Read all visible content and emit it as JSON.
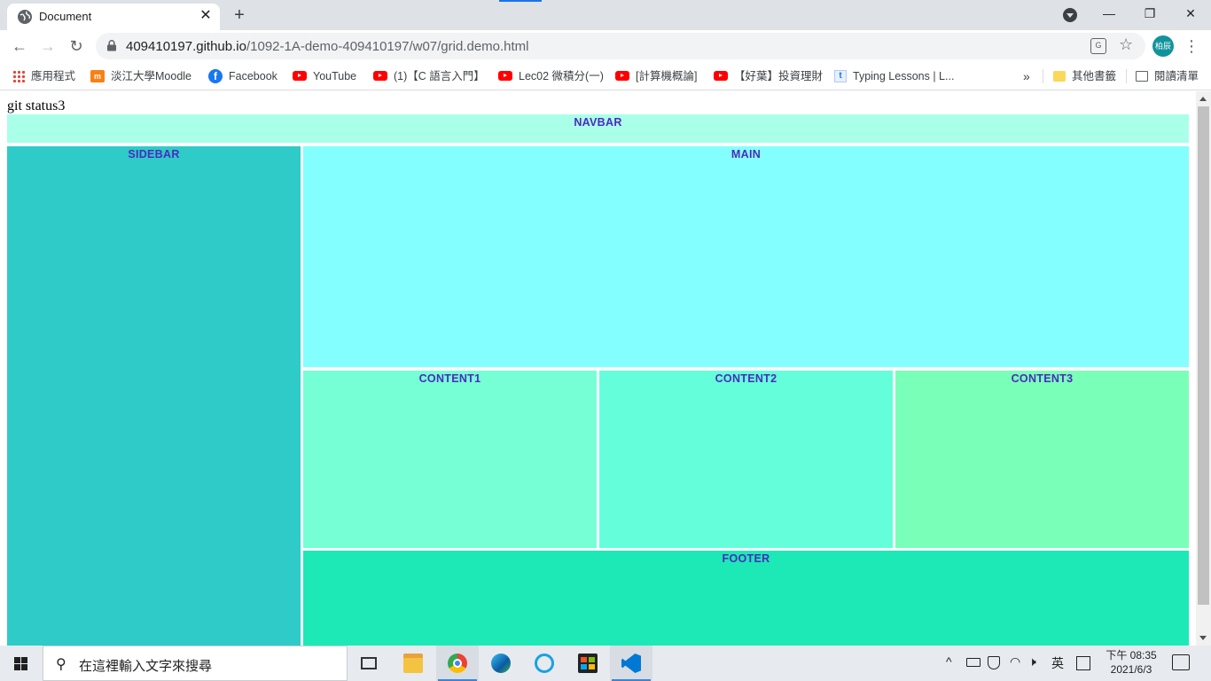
{
  "browser": {
    "tab_title": "Document",
    "tab_close": "✕",
    "new_tab": "+",
    "window": {
      "minimize": "—",
      "restore": "❐",
      "close": "✕"
    },
    "nav": {
      "back": "←",
      "forward": "→",
      "reload": "↻"
    },
    "url_host": "409410197.github.io",
    "url_path": "/1092-1A-demo-409410197/w07/grid.demo.html",
    "translate_icon_text": "G",
    "star": "☆",
    "profile_initials": "柏辰",
    "menu": "⋮"
  },
  "bookmarks": {
    "items": [
      {
        "label": "應用程式",
        "icon": "apps-icon"
      },
      {
        "label": "淡江大學Moodle",
        "icon": "moodle-icon"
      },
      {
        "label": "Facebook",
        "icon": "facebook-icon"
      },
      {
        "label": "YouTube",
        "icon": "youtube-icon"
      },
      {
        "label": "(1)【C 語言入門】",
        "icon": "youtube-icon"
      },
      {
        "label": "Lec02 微積分(一)",
        "icon": "youtube-icon"
      },
      {
        "label": "[計算機概論]",
        "icon": "youtube-icon"
      },
      {
        "label": "【好葉】投資理財",
        "icon": "youtube-icon"
      },
      {
        "label": "Typing Lessons | L...",
        "icon": "typing-icon"
      }
    ],
    "overflow": "»",
    "other": "其他書籤",
    "reading_list": "閱讀清單"
  },
  "page": {
    "heading": "git status3",
    "cells": {
      "navbar": "NAVBAR",
      "sidebar": "SIDEBAR",
      "main": "MAIN",
      "content1": "CONTENT1",
      "content2": "CONTENT2",
      "content3": "CONTENT3",
      "footer": "FOOTER"
    },
    "colors": {
      "navbar": "#aaffe9",
      "sidebar": "#2ecbc9",
      "main": "#84ffff",
      "content1": "#76ffd5",
      "content2": "#64ffda",
      "content3": "#7affb9",
      "footer": "#1de9b6",
      "label": "#4b2bbd"
    }
  },
  "taskbar": {
    "search_placeholder": "在這裡輸入文字來搜尋",
    "search_icon": "⚲",
    "tray": {
      "chevron": "^",
      "ime": "英"
    },
    "time": "下午 08:35",
    "date": "2021/6/3"
  }
}
